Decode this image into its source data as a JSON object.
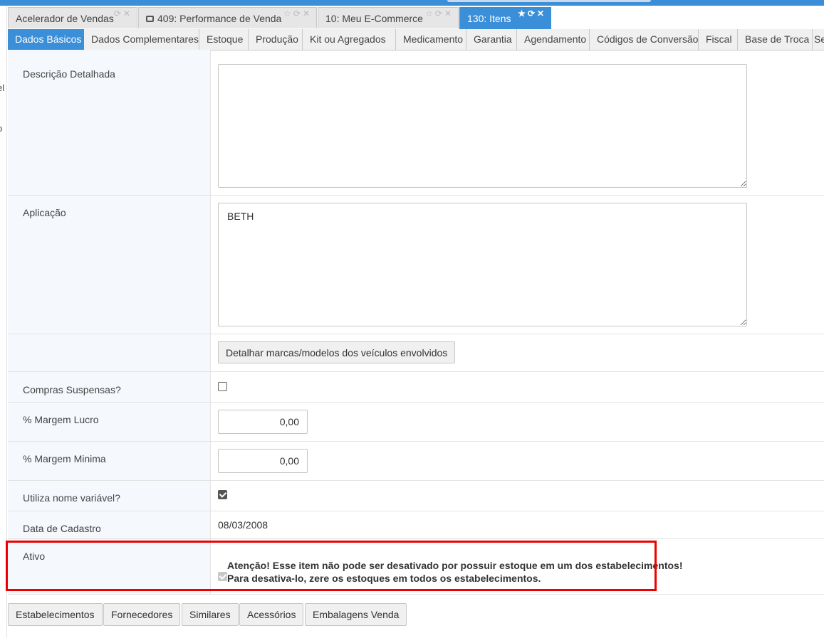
{
  "window_tabs": [
    {
      "label": "Acelerador de Vendas",
      "active": false
    },
    {
      "label": "409: Performance de Venda",
      "active": false
    },
    {
      "label": "10: Meu E-Commerce",
      "active": false
    },
    {
      "label": "130: Itens",
      "active": true
    }
  ],
  "section_tabs": [
    "Dados Básicos",
    "Dados Complementares",
    "Estoque",
    "Produção",
    "Kit ou Agregados",
    "Medicamento",
    "Garantia",
    "Agendamento",
    "Códigos de Conversão",
    "Fiscal",
    "Base de Troca",
    "Se"
  ],
  "left_fragments": [
    "el",
    "o"
  ],
  "form": {
    "descricao_label": "Descrição Detalhada",
    "descricao_value": "",
    "aplicacao_label": "Aplicação",
    "aplicacao_value": "BETH",
    "detalhar_button": "Detalhar marcas/modelos dos veículos envolvidos",
    "compras_label": "Compras Suspensas?",
    "compras_checked": false,
    "margem_lucro_label": "% Margem Lucro",
    "margem_lucro_value": "0,00",
    "margem_minima_label": "% Margem Minima",
    "margem_minima_value": "0,00",
    "nome_variavel_label": "Utiliza nome variável?",
    "nome_variavel_checked": true,
    "data_cadastro_label": "Data de Cadastro",
    "data_cadastro_value": "08/03/2008",
    "ativo_label": "Ativo",
    "ativo_warning_line1": "Atenção! Esse item não pode ser desativado por possuir estoque em um dos estabelecimentos!",
    "ativo_warning_line2": "Para desativa-lo, zere os estoques em todos os estabelecimentos."
  },
  "bottom_buttons": [
    "Estabelecimentos",
    "Fornecedores",
    "Similares",
    "Acessórios",
    "Embalagens Venda"
  ],
  "colors": {
    "accent": "#3b8fd8",
    "alert_border": "#e00000"
  }
}
